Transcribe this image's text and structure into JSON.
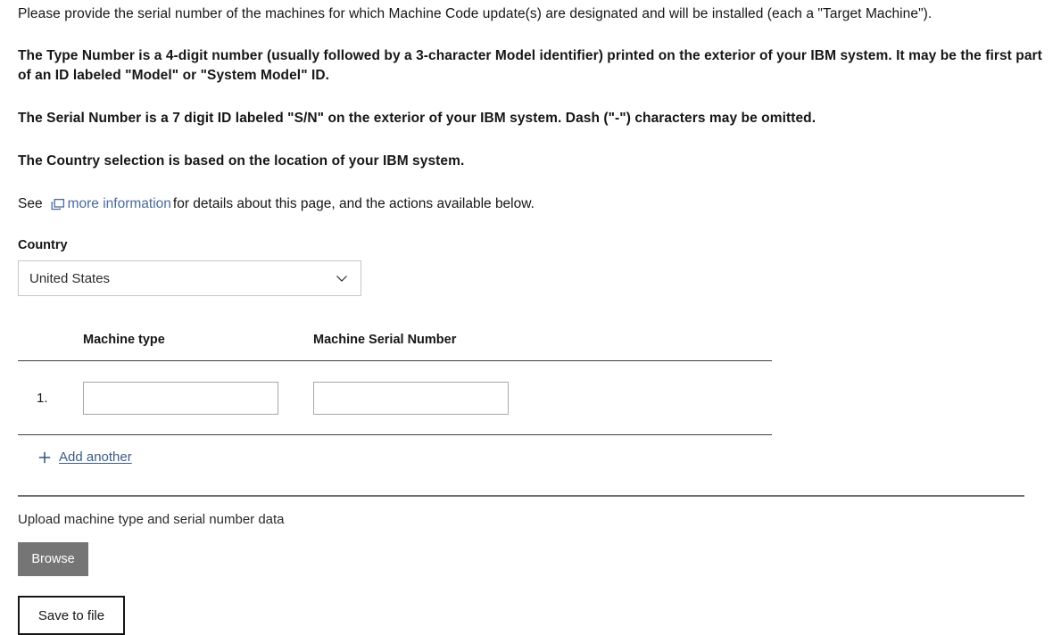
{
  "intro": {
    "paragraph1": "Please provide the serial number of the machines for which Machine Code update(s) are designated and will be installed (each a \"Target Machine\").",
    "paragraph2": "The Type Number is a 4-digit number (usually followed by a 3-character Model identifier) printed on the exterior of your IBM system. It may be the first part of an ID labeled \"Model\" or \"System Model\" ID.",
    "paragraph3": "The Serial Number is a 7 digit ID labeled \"S/N\" on the exterior of your IBM system. Dash (\"-\") characters may be omitted.",
    "paragraph4": "The Country selection is based on the location of your IBM system."
  },
  "see_line": {
    "prefix": "See",
    "link_icon": "launch-icon",
    "link_text": "more information",
    "suffix": "for details about this page, and the actions available below."
  },
  "country": {
    "label": "Country",
    "selected": "United States",
    "chevron_icon": "chevron-down-icon",
    "options": [
      "United States"
    ]
  },
  "machines": {
    "columns": {
      "number": "",
      "machine_type": "Machine type",
      "serial_number": "Machine Serial Number"
    },
    "rows": [
      {
        "index": "1.",
        "machine_type": "",
        "machine_type_placeholder": "",
        "serial_number": "",
        "serial_number_placeholder": ""
      }
    ],
    "add_another": {
      "icon": "plus-icon",
      "label": "Add another"
    }
  },
  "upload": {
    "label": "Upload machine type and serial number data",
    "browse_label": "Browse",
    "save_label": "Save to file"
  },
  "colors": {
    "text": "#161616",
    "link": "#3d5a87",
    "link_info": "#4a6b99",
    "input_border": "#a8a8a8",
    "select_border": "#c6c6c6",
    "rule": "#3f3f3f",
    "divider": "#6f6f6f",
    "browse_bg": "#757575",
    "browse_text": "#ffffff",
    "background": "#ffffff"
  }
}
